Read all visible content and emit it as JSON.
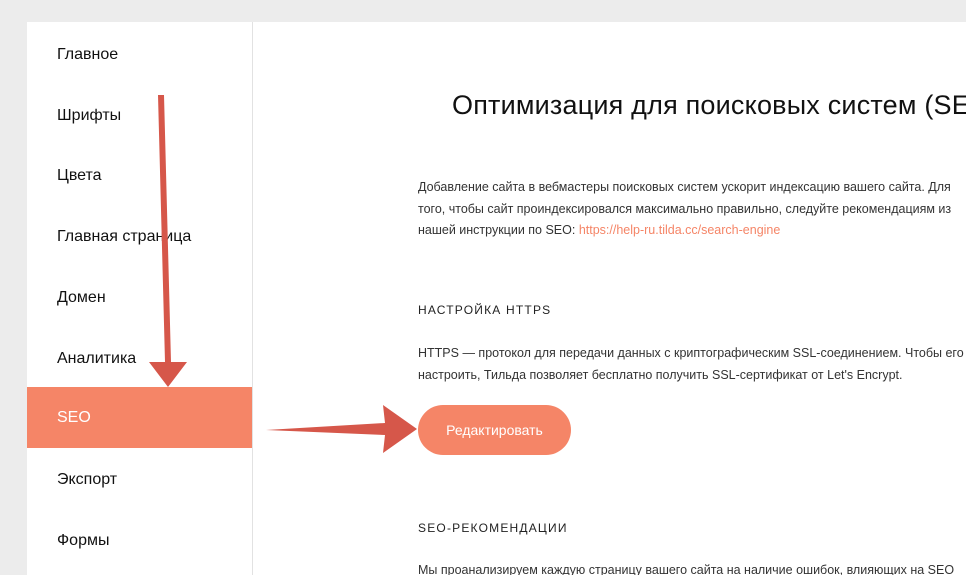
{
  "sidebar": {
    "items": [
      {
        "label": "Главное"
      },
      {
        "label": "Шрифты"
      },
      {
        "label": "Цвета"
      },
      {
        "label": "Главная страница"
      },
      {
        "label": "Домен"
      },
      {
        "label": "Аналитика"
      },
      {
        "label": "SEO"
      },
      {
        "label": "Экспорт"
      },
      {
        "label": "Формы"
      }
    ],
    "active": "SEO"
  },
  "main": {
    "title": "Оптимизация для поисковых систем (SEO)",
    "intro_text": "Добавление сайта в вебмастеры поисковых систем ускорит индексацию вашего сайта. Для того, чтобы сайт проиндексировался максимально правильно, следуйте рекомендациям из нашей инструкции по SEO: ",
    "intro_link": "https://help-ru.tilda.cc/search-engine",
    "https_heading": "НАСТРОЙКА HTTPS",
    "https_text": "HTTPS — протокол для передачи данных с криптографическим SSL-соединением. Чтобы его настроить, Тильда позволяет бесплатно получить SSL-сертификат от Let's Encrypt.",
    "edit_button": "Редактировать",
    "seo_heading": "SEO-РЕКОМЕНДАЦИИ",
    "seo_text": "Мы проанализируем каждую страницу вашего сайта на наличие ошибок, влияющих на SEO"
  },
  "colors": {
    "accent": "#f58567",
    "annotation_arrow": "#d6574a"
  }
}
